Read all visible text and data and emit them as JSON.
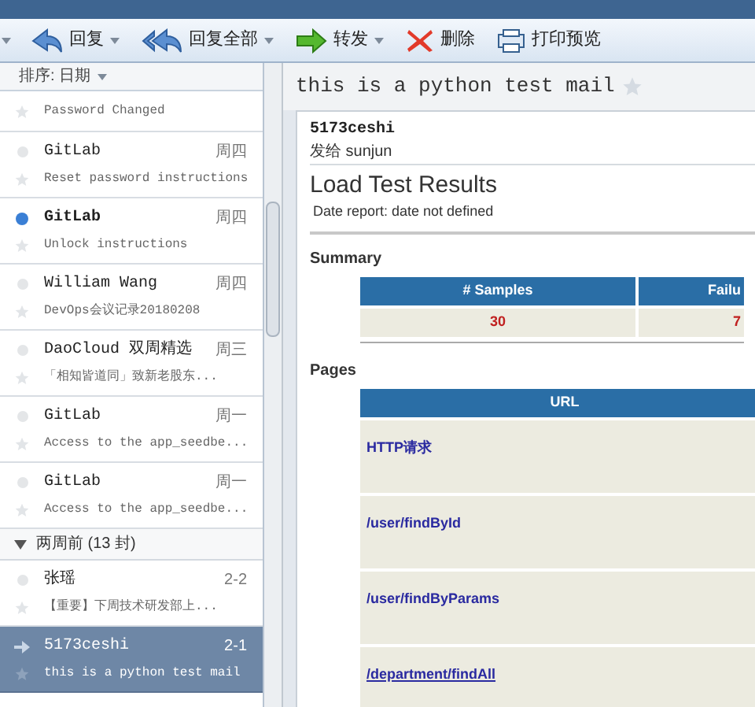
{
  "toolbar": [
    {
      "kind": "menu"
    },
    {
      "kind": "reply",
      "label": "回复",
      "menu": true
    },
    {
      "kind": "reply_all",
      "label": "回复全部",
      "menu": true
    },
    {
      "kind": "forward",
      "label": "转发",
      "menu": true
    },
    {
      "kind": "delete",
      "label": "删除",
      "menu": false
    },
    {
      "kind": "print",
      "label": "打印预览",
      "menu": false
    }
  ],
  "sort": {
    "label": "排序: 日期"
  },
  "messages": [
    {
      "kind": "mail",
      "subject": "Password Changed",
      "unread": false,
      "replied": false,
      "selected": false,
      "partial": true
    },
    {
      "kind": "mail",
      "sender": "GitLab",
      "date": "周四",
      "subject": "Reset password instructions",
      "unread": false,
      "replied": false,
      "selected": false
    },
    {
      "kind": "mail",
      "sender": "GitLab",
      "date": "周四",
      "subject": "Unlock instructions",
      "unread": true,
      "replied": false,
      "selected": false
    },
    {
      "kind": "mail",
      "sender": "William Wang",
      "date": "周四",
      "subject": "DevOps会议记录20180208",
      "unread": false,
      "replied": false,
      "selected": false
    },
    {
      "kind": "mail",
      "sender": "DaoCloud 双周精选",
      "date": "周三",
      "subject": "「相知皆道同」致新老股东...",
      "unread": false,
      "replied": false,
      "selected": false
    },
    {
      "kind": "mail",
      "sender": "GitLab",
      "date": "周一",
      "subject": "Access to the app_seedbe...",
      "unread": false,
      "replied": false,
      "selected": false
    },
    {
      "kind": "mail",
      "sender": "GitLab",
      "date": "周一",
      "subject": "Access to the app_seedbe...",
      "unread": false,
      "replied": false,
      "selected": false
    },
    {
      "kind": "group",
      "label": "两周前 (13 封)",
      "expanded": true
    },
    {
      "kind": "mail",
      "sender": "张瑶",
      "date": "2-2",
      "subject": "【重要】下周技术研发部上...",
      "unread": false,
      "replied": false,
      "selected": false
    },
    {
      "kind": "mail",
      "sender": "5173ceshi",
      "date": "2-1",
      "subject": "this is a python test mail",
      "unread": false,
      "replied": true,
      "selected": true
    }
  ],
  "mail": {
    "subject": "this is a python test mail",
    "from": "5173ceshi",
    "to": "发给 sunjun",
    "report_title": "Load Test Results",
    "report_date": "Date report: date not defined",
    "summary_heading": "Summary",
    "summary_columns": [
      "# Samples",
      "Failu"
    ],
    "summary_values": [
      "30",
      "7"
    ],
    "pages_heading": "Pages",
    "pages_column": "URL",
    "pages": [
      {
        "url": "HTTP请求",
        "underlined": false
      },
      {
        "url": "/user/findById",
        "underlined": false
      },
      {
        "url": "/user/findByParams",
        "underlined": false
      },
      {
        "url": "/department/findAll",
        "underlined": true
      }
    ]
  }
}
